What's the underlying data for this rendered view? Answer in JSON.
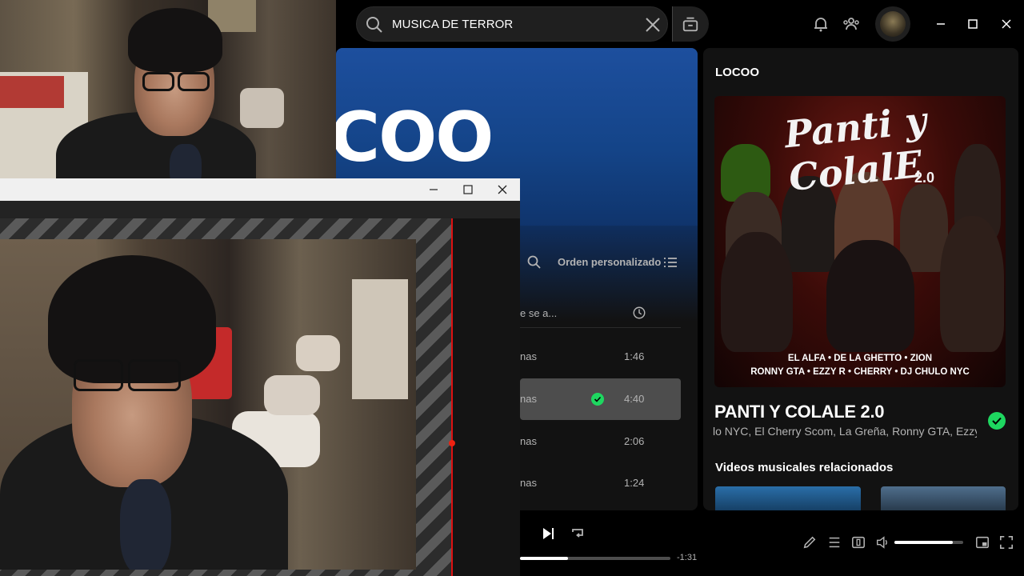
{
  "search": {
    "query": "MUSICA DE TERROR"
  },
  "playlist": {
    "title_fragment": "COO",
    "order_label": "Orden personalizado",
    "column_added_fragment": "e se a...",
    "tracks": [
      {
        "added": "nas",
        "duration": "1:46",
        "active": false,
        "saved": false
      },
      {
        "added": "nas",
        "duration": "4:40",
        "active": true,
        "saved": true
      },
      {
        "added": "nas",
        "duration": "2:06",
        "active": false,
        "saved": false
      },
      {
        "added": "nas",
        "duration": "1:24",
        "active": false,
        "saved": false
      }
    ]
  },
  "now_playing": {
    "header": "LOCOO",
    "cover": {
      "title_line1": "Panti y",
      "title_line2": "ColalE",
      "version": "2.0",
      "credits_line1": "EL ALFA • DE LA GHETTO • ZION",
      "credits_line2": "RONNY GTA • EZZY R • CHERRY • DJ CHULO NYC"
    },
    "title": "PANTI Y COLALE 2.0",
    "artists": "lo NYC, El Cherry Scom, La Greña, Ronny GTA, Ezzy",
    "related_videos_label": "Videos musicales relacionados"
  },
  "player": {
    "time_remaining": "-1:31",
    "progress_fraction": 0.32,
    "volume_fraction": 0.85
  },
  "colors": {
    "accent_green": "#1ed760",
    "banner_blue": "#1d4f9e",
    "record_red": "#dd1111"
  },
  "icons": [
    "search-icon",
    "close-icon",
    "browse-icon",
    "bell-icon",
    "friends-icon",
    "minimize-icon",
    "maximize-icon",
    "close-window-icon",
    "list-icon",
    "clock-icon",
    "check-icon",
    "next-icon",
    "repeat-icon",
    "lyrics-icon",
    "queue-icon",
    "connect-device-icon",
    "volume-icon",
    "miniplayer-icon",
    "fullscreen-icon"
  ]
}
